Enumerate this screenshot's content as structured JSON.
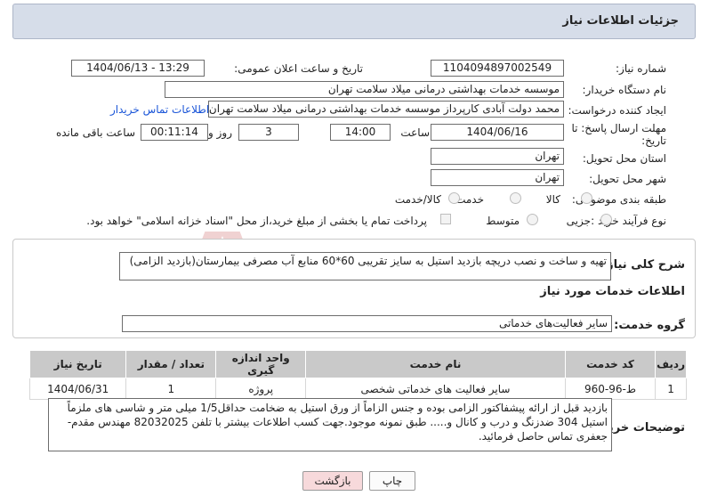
{
  "header": {
    "title": "جزئیات اطلاعات نیاز"
  },
  "form": {
    "need_number_label": "شماره نیاز:",
    "need_number": "1104094897002549",
    "announce_label": "تاریخ و ساعت اعلان عمومی:",
    "announce_value": "1404/06/13 - 13:29",
    "buyer_label": "نام دستگاه خریدار:",
    "buyer_value": "موسسه خدمات بهداشتی درمانی میلاد سلامت تهران",
    "requester_label": "ایجاد کننده درخواست:",
    "requester_value": "محمد دولت آبادی کارپرداز موسسه خدمات بهداشتی درمانی میلاد سلامت تهران",
    "contact_link": "اطلاعات تماس خریدار",
    "deadline_label_1": "مهلت ارسال پاسخ: تا",
    "deadline_label_2": "تاریخ:",
    "deadline_date": "1404/06/16",
    "time_label": "ساعت",
    "deadline_time": "14:00",
    "days_value": "3",
    "days_label": "روز و",
    "remaining_value": "00:11:14",
    "remaining_label": "ساعت باقی مانده",
    "province_label": "استان محل تحویل:",
    "province_value": "تهران",
    "city_label": "شهر محل تحویل:",
    "city_value": "تهران",
    "category_label": "طبقه بندی موضوعی:",
    "category_options": [
      "کالا",
      "خدمت",
      "کالا/خدمت"
    ],
    "process_label": "نوع فرآیند خرید :",
    "process_options": [
      "جزیی",
      "متوسط"
    ],
    "payment_note": "پرداخت تمام یا بخشی از مبلغ خرید،از محل \"اسناد خزانه اسلامی\" خواهد بود."
  },
  "summary": {
    "label": "شرح کلی نیاز:",
    "text": "تهیه و ساخت و نصب دریچه بازدید استیل به سایز تقریبی 60*60 منابع آب مصرفی بیمارستان(بازدید الزامی)"
  },
  "services": {
    "section_title": "اطلاعات خدمات مورد نیاز",
    "group_label": "گروه خدمت:",
    "group_value": "سایر فعالیت‌های خدماتی",
    "columns": [
      "ردیف",
      "کد خدمت",
      "نام خدمت",
      "واحد اندازه گیری",
      "تعداد / مقدار",
      "تاریخ نیاز"
    ],
    "rows": [
      [
        "1",
        "ط-96-960",
        "سایر فعالیت های خدماتی شخصی",
        "پروژه",
        "1",
        "1404/06/31"
      ]
    ]
  },
  "notes": {
    "label": "توضیحات خریدار:",
    "text": "بازدید قبل از ارائه پیشفاکتور الزامی بوده و جنس الزاماً از ورق استیل به ضخامت حداقل1/5 میلی متر و شاسی های ملزماً استیل 304 ضدزنگ و درب و کانال و..... طبق نمونه موجود.جهت کسب اطلاعات بیشتر با تلفن 82032025 مهندس مقدم-جعفری تماس حاصل فرمائید."
  },
  "buttons": {
    "print": "چاپ",
    "back": "بازگشت"
  },
  "watermark": {
    "text": "AriaTender.neT"
  },
  "colors": {
    "header_bg": "#d6dde9",
    "back_button_bg": "#f7d9db",
    "link": "#1a55d8",
    "watermark": "#f0d2d2"
  }
}
